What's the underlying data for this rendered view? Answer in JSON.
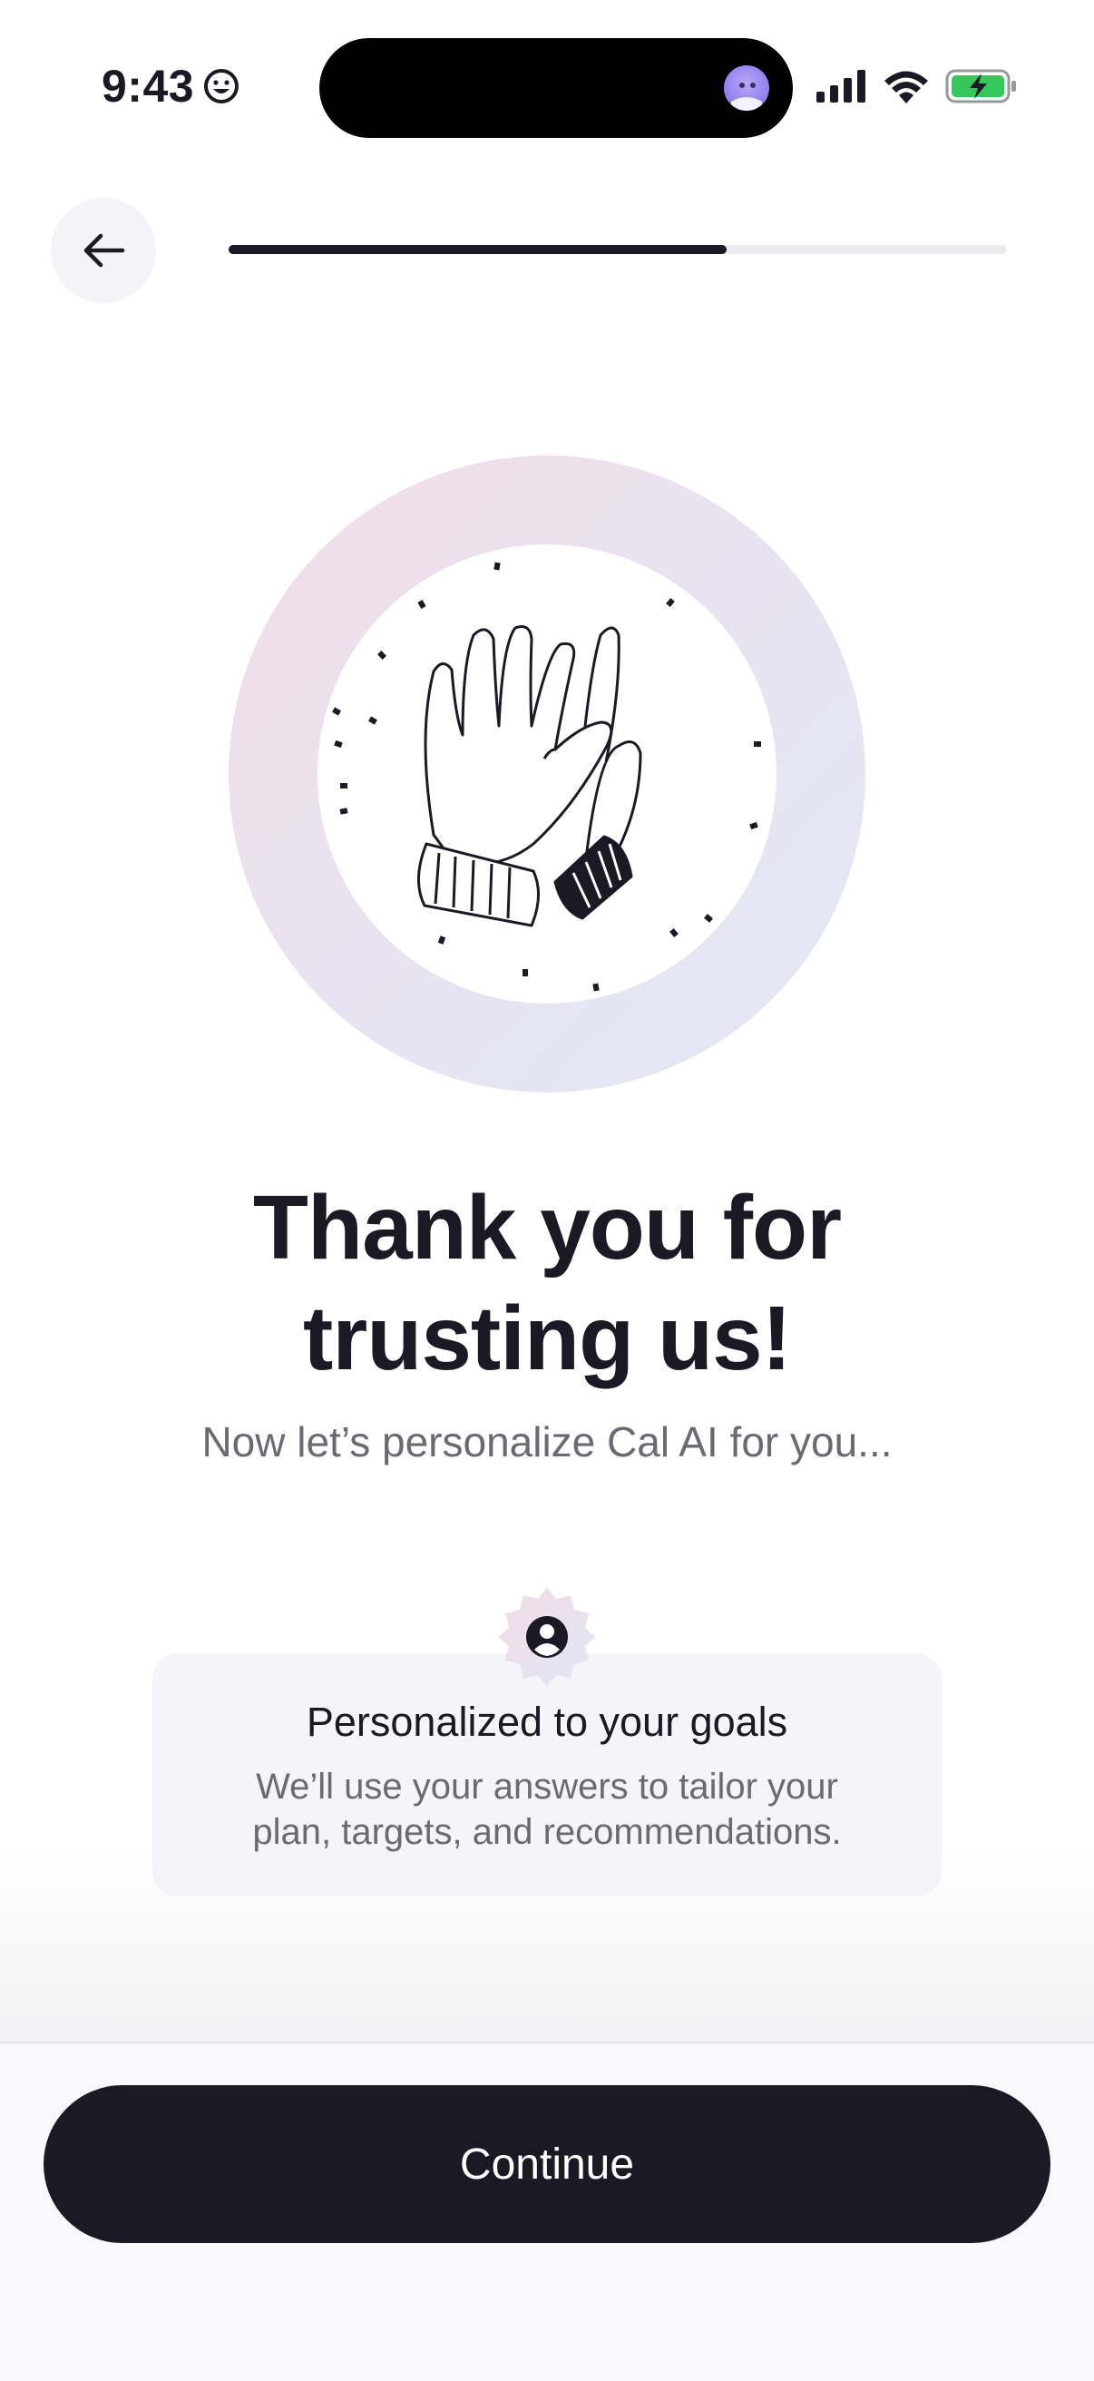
{
  "status_bar": {
    "time": "9:43",
    "emoji_icon": "smiley-face-icon",
    "signal_icon": "cellular-signal-icon",
    "wifi_icon": "wifi-icon",
    "battery_icon": "battery-charging-icon",
    "battery_color": "#34c759"
  },
  "header": {
    "back_icon": "arrow-left-icon",
    "progress_fraction": 0.64
  },
  "illustration": {
    "icon": "high-five-gloves-icon"
  },
  "content": {
    "title_line1": "Thank you for",
    "title_line2": "trusting us!",
    "subtitle": "Now let’s personalize Cal AI for you..."
  },
  "card": {
    "badge_icon": "user-circle-icon",
    "title": "Personalized to your goals",
    "desc_line1": "We’ll use your answers to tailor your",
    "desc_line2": "plan, targets, and recommendations."
  },
  "footer": {
    "continue_label": "Continue"
  },
  "colors": {
    "primary": "#1b1a24",
    "muted_text": "#6b6a72",
    "card_bg": "#f4f4f9"
  }
}
